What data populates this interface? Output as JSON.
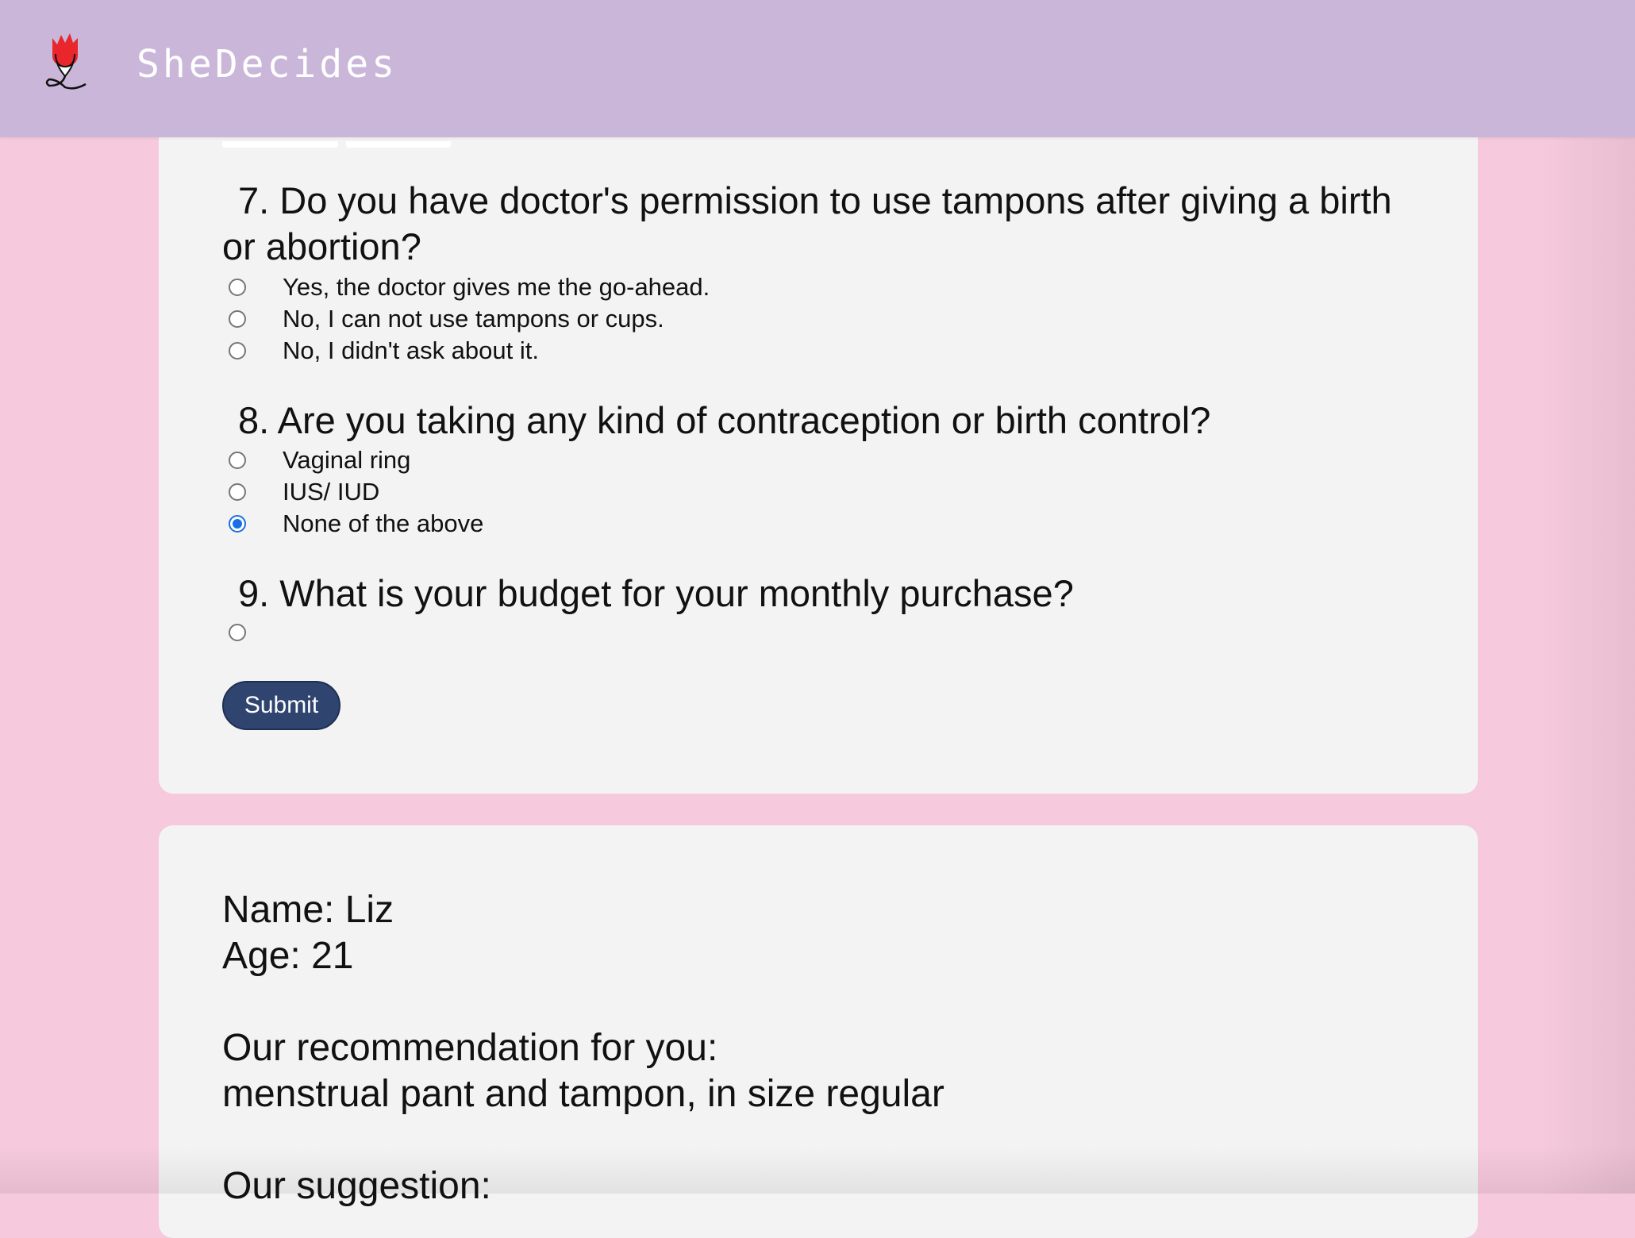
{
  "header": {
    "brand": "SheDecides",
    "logo_icon": "tulip-logo-icon"
  },
  "colors": {
    "background": "#f6c9dc",
    "header": "#c9b6d9",
    "card": "#f3f3f3",
    "submit": "#2f4570",
    "radio_checked": "#1a6fe6"
  },
  "quiz": {
    "questions": [
      {
        "number": "7.",
        "text": "Do you have doctor's permission to use tampons after giving a birth or abortion?",
        "options": [
          {
            "label": "Yes, the doctor gives me the go-ahead.",
            "checked": false
          },
          {
            "label": "No, I can not use tampons or cups.",
            "checked": false
          },
          {
            "label": "No, I didn't ask about it.",
            "checked": false
          }
        ]
      },
      {
        "number": "8.",
        "text": "Are you taking any kind of contraception or birth control?",
        "options": [
          {
            "label": "Vaginal ring",
            "checked": false
          },
          {
            "label": "IUS/ IUD",
            "checked": false
          },
          {
            "label": "None of the above",
            "checked": true
          }
        ]
      },
      {
        "number": "9.",
        "text": "What is your budget for your monthly purchase?",
        "options": [
          {
            "label": "",
            "checked": false
          }
        ]
      }
    ],
    "submit_label": "Submit"
  },
  "result": {
    "name_line": "Name: Liz",
    "age_line": "Age: 21",
    "recommendation_heading": "Our recommendation for you:",
    "recommendation_text": "menstrual pant and tampon, in size regular",
    "suggestion_heading": "Our suggestion:"
  }
}
